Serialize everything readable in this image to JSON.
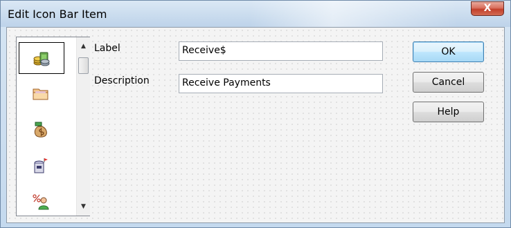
{
  "window": {
    "title": "Edit Icon Bar Item",
    "close_glyph": "X"
  },
  "icon_list": {
    "items": [
      {
        "icon": "coins-icon",
        "selected": true
      },
      {
        "icon": "folder-icon",
        "selected": false
      },
      {
        "icon": "money-bag-icon",
        "selected": false
      },
      {
        "icon": "mailbox-icon",
        "selected": false
      },
      {
        "icon": "percent-person-icon",
        "selected": false
      }
    ],
    "scroll_up_glyph": "▲",
    "scroll_down_glyph": "▼"
  },
  "form": {
    "label_caption": "Label",
    "label_value": "Receive$",
    "description_caption": "Description",
    "description_value": "Receive Payments"
  },
  "buttons": {
    "ok": "OK",
    "cancel": "Cancel",
    "help": "Help"
  },
  "colors": {
    "default_button_border": "#3c7fb1",
    "close_button": "#c2402b"
  }
}
